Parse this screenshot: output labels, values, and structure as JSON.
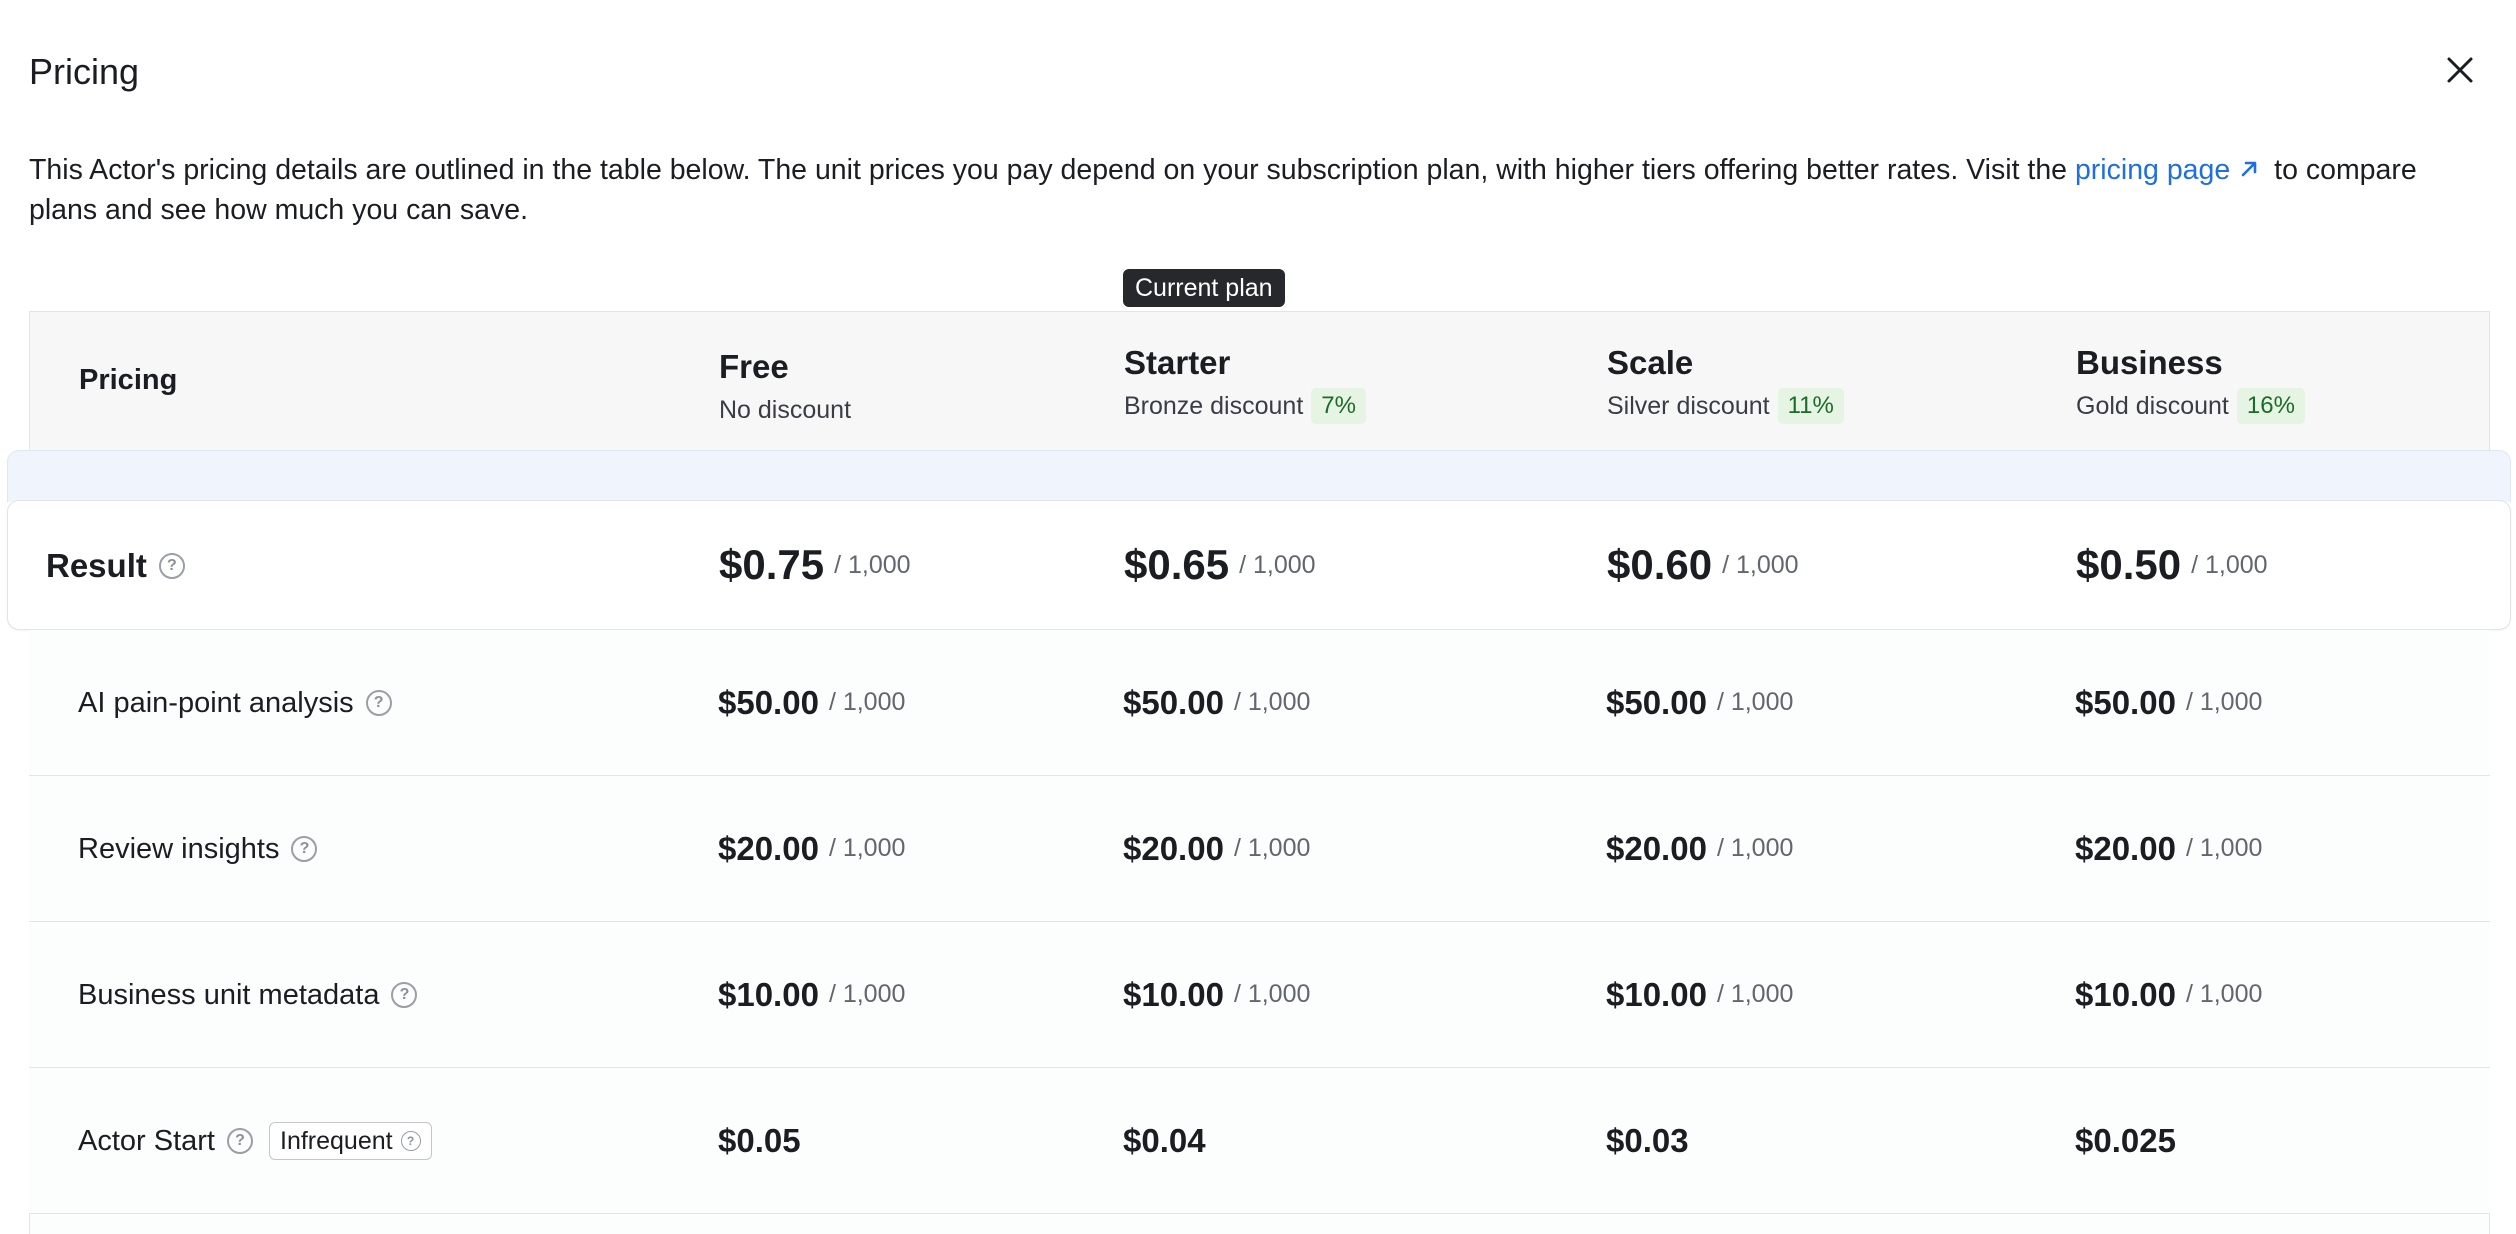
{
  "dialog": {
    "title": "Pricing",
    "intro_before_link": "This Actor's pricing details are outlined in the table below. The unit prices you pay depend on your subscription plan, with higher tiers offering better rates. Visit the ",
    "intro_link": "pricing page",
    "intro_after_link": " to compare plans and see how much you can save."
  },
  "current_plan_badge": "Current plan",
  "table": {
    "header_label": "Pricing",
    "plans": [
      {
        "name": "Free",
        "discount_label": "No discount",
        "discount_pct": ""
      },
      {
        "name": "Starter",
        "discount_label": "Bronze discount",
        "discount_pct": "7%"
      },
      {
        "name": "Scale",
        "discount_label": "Silver discount",
        "discount_pct": "11%"
      },
      {
        "name": "Business",
        "discount_label": "Gold discount",
        "discount_pct": "16%"
      }
    ],
    "unit_suffix": "/ 1,000",
    "result_row": {
      "label": "Result",
      "prices": [
        "$0.75",
        "$0.65",
        "$0.60",
        "$0.50"
      ]
    },
    "rows": [
      {
        "label": "AI pain-point analysis",
        "prices": [
          "$50.00",
          "$50.00",
          "$50.00",
          "$50.00"
        ]
      },
      {
        "label": "Review insights",
        "prices": [
          "$20.00",
          "$20.00",
          "$20.00",
          "$20.00"
        ]
      },
      {
        "label": "Business unit metadata",
        "prices": [
          "$10.00",
          "$10.00",
          "$10.00",
          "$10.00"
        ]
      }
    ],
    "actor_start_row": {
      "label": "Actor Start",
      "tag": "Infrequent",
      "prices": [
        "$0.05",
        "$0.04",
        "$0.03",
        "$0.025"
      ]
    }
  },
  "colors": {
    "link": "#1f6fe0",
    "badge_bg": "#e5f4e3",
    "badge_text": "#1d6b2b",
    "result_band": "#f0f4fd"
  },
  "icons": {
    "close": "close-icon",
    "external": "external-link-icon",
    "help": "help-icon"
  }
}
